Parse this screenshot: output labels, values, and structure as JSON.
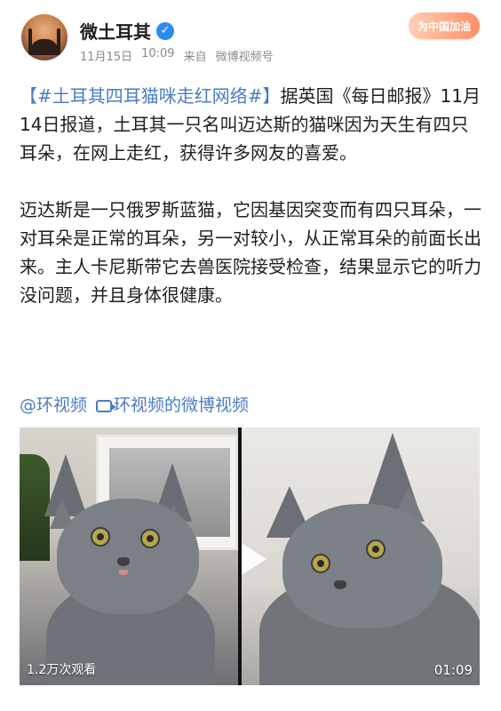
{
  "post": {
    "author": "微土耳其",
    "date": "11月15日",
    "time": "10:09",
    "source_prefix": "来自",
    "source": "微博视频号",
    "badge_label": "为中国加油",
    "hashtag": "【#土耳其四耳猫咪走红网络#】",
    "paragraph1": "据英国《每日邮报》11月14日报道，土耳其一只名叫迈达斯的猫咪因为天生有四只耳朵，在网上走红，获得许多网友的喜爱。",
    "paragraph2": "迈达斯是一只俄罗斯蓝猫，它因基因突变而有四只耳朵，一对耳朵是正常的耳朵，另一对较小，从正常耳朵的前面长出来。主人卡尼斯带它去兽医院接受检查，结果显示它的听力没问题，并且身体很健康。",
    "mention": "@环视频",
    "video_link": "环视频的微博视频"
  },
  "media": {
    "views": "1.2万次观看",
    "duration": "01:09"
  },
  "icons": {
    "verified": "verified-check-icon",
    "video": "video-camera-icon",
    "play": "play-icon"
  },
  "colors": {
    "link": "#4c7cc2",
    "verified": "#2d8cf0",
    "meta": "#8a8a8a"
  }
}
